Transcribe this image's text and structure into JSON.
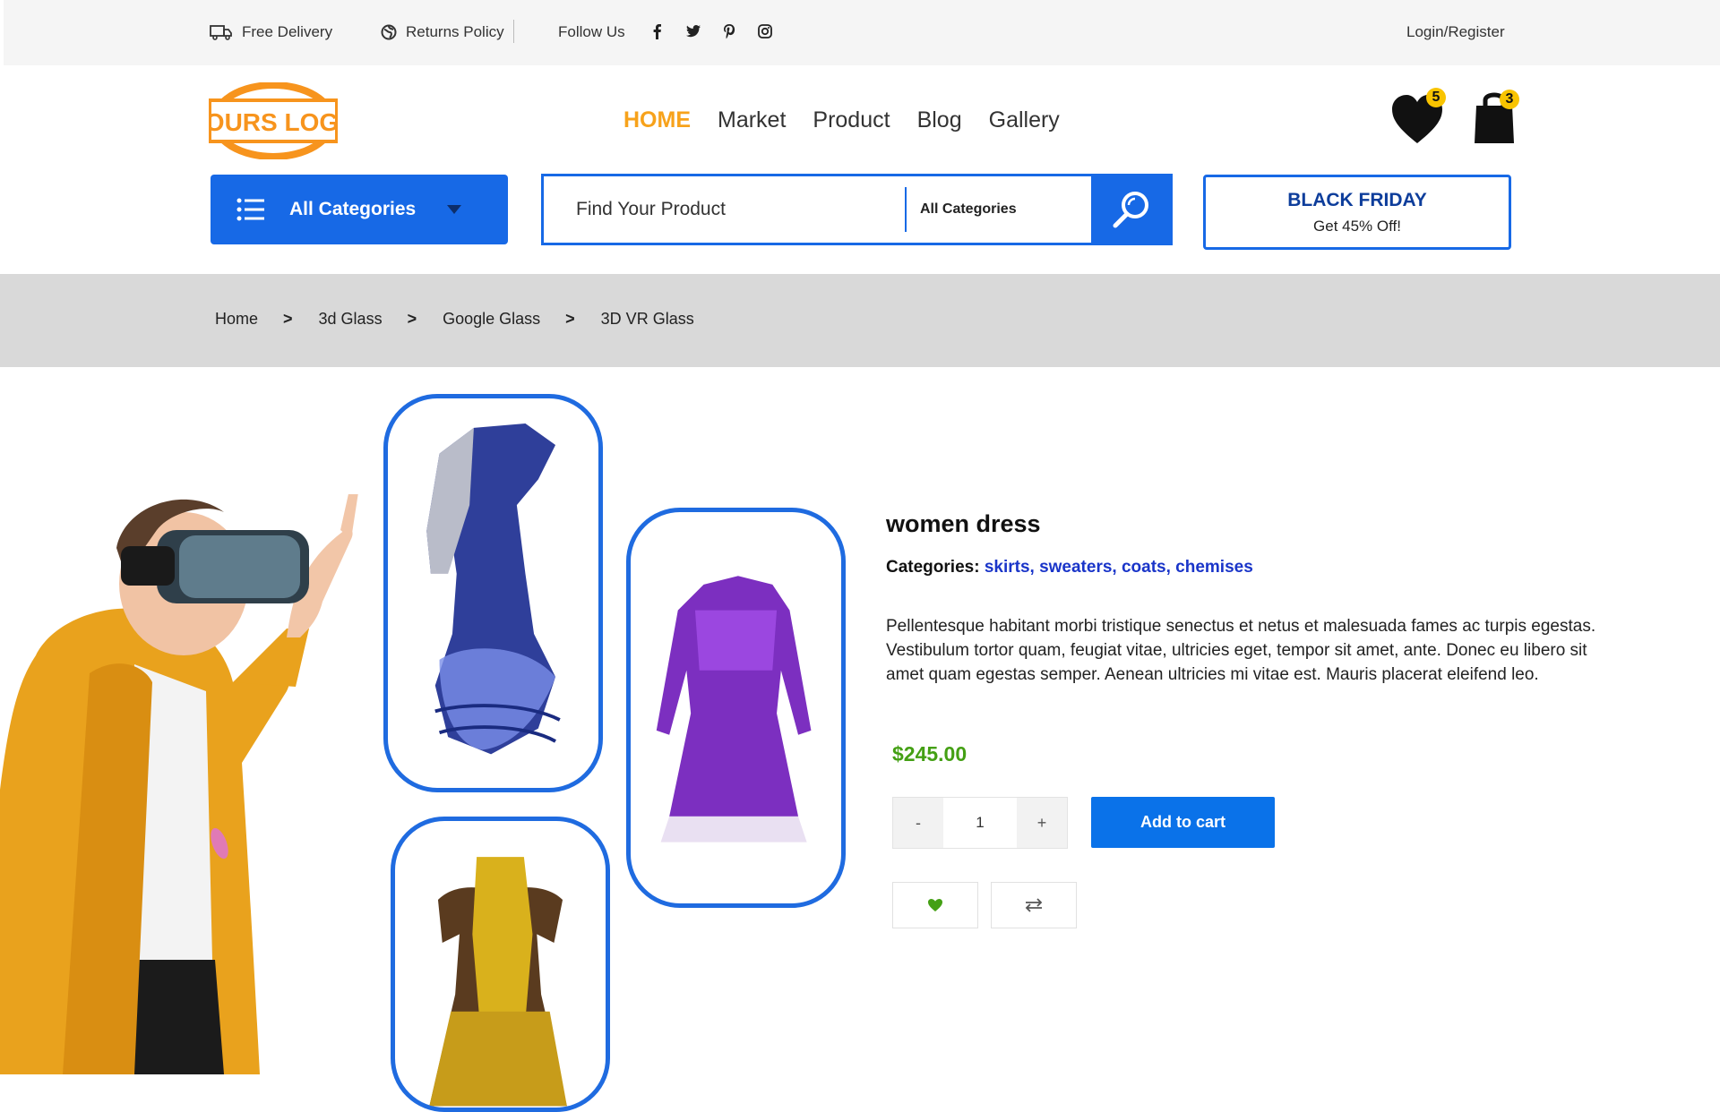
{
  "topbar": {
    "delivery": "Free Delivery",
    "returns": "Returns Policy",
    "follow": "Follow Us",
    "login": "Login/Register",
    "social_icons": [
      "facebook-icon",
      "twitter-icon",
      "pinterest-icon",
      "instagram-icon"
    ]
  },
  "header": {
    "logo_text": "YOURS LOGO",
    "nav": [
      "HOME",
      "Market",
      "Product",
      "Blog",
      "Gallery"
    ],
    "wishlist_count": "5",
    "cart_count": "3"
  },
  "search": {
    "all_categories": "All Categories",
    "placeholder": "Find Your Product",
    "category_select": "All Categories"
  },
  "promo": {
    "title": "BLACK FRIDAY",
    "subtitle": "Get 45% Off!"
  },
  "breadcrumb": {
    "items": [
      "Home",
      "3d Glass",
      "Google Glass",
      "3D VR Glass"
    ],
    "separator": ">"
  },
  "product": {
    "title": "women dress",
    "categories_label": "Categories:",
    "categories": "skirts, sweaters, coats, chemises",
    "description": "Pellentesque habitant morbi tristique senectus et netus et malesuada fames ac turpis egestas. Vestibulum tortor quam, feugiat vitae, ultricies eget, tempor sit amet, ante. Donec eu libero sit amet quam egestas semper. Aenean ultricies mi vitae est. Mauris placerat eleifend leo.",
    "price": "$245.00",
    "qty_minus": "-",
    "quantity": "1",
    "qty_plus": "+",
    "add_to_cart": "Add to cart"
  },
  "colors": {
    "accent": "#1769e6",
    "brand_orange": "#f7a21b",
    "price_green": "#44a014",
    "category_link": "#1a35c9"
  }
}
